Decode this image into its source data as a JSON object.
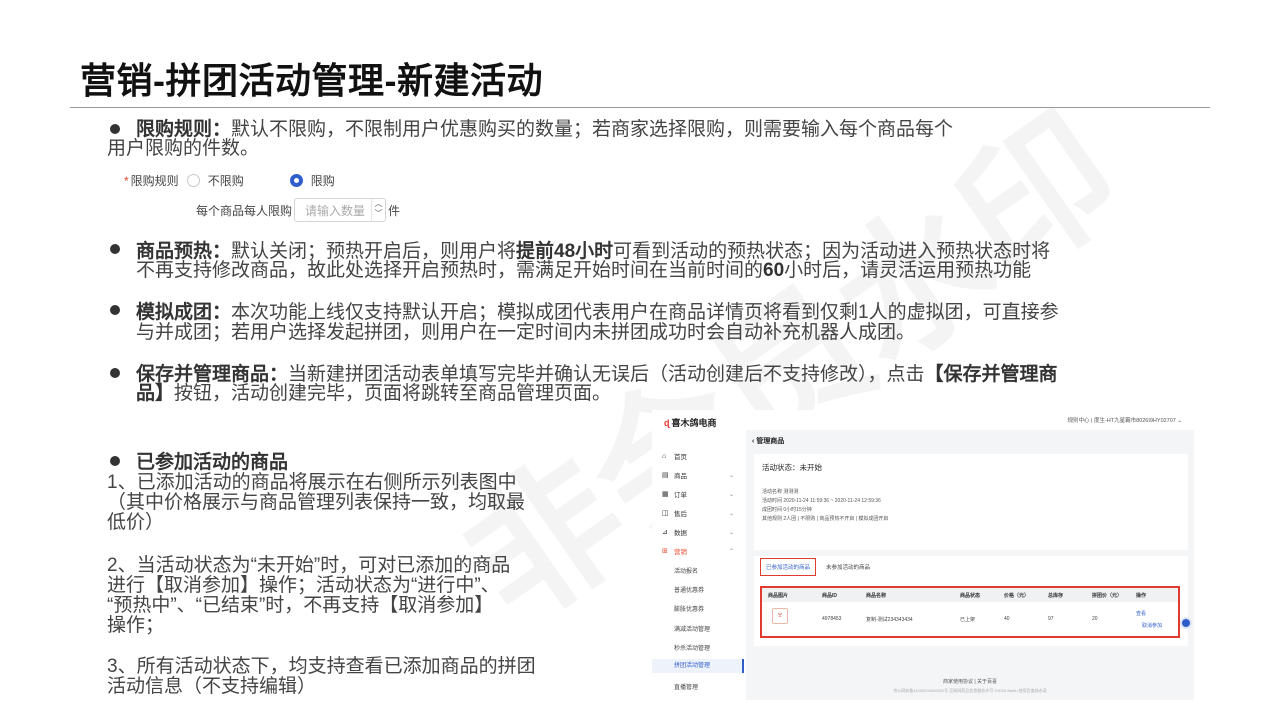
{
  "page": {
    "title": "营销-拼团活动管理-新建活动",
    "watermark": "非会员水印"
  },
  "sections": {
    "limit": {
      "label": "限购规则：",
      "text1": "默认不限购，不限制用户优惠购买的数量；若商家选择限购，则需要输入每个商品每个",
      "text2": "用户限购的件数。"
    },
    "preheat": {
      "label": "商品预热：",
      "text1a": "默认关闭；预热开启后，则用户将",
      "text1b": "提前48小时",
      "text1c": "可看到活动的预热状态；因为活动进入预热状态时将",
      "text2a": "不再支持修改商品，故此处选择开启预热时，需满足开始时间在当前时间的",
      "text2b": "60",
      "text2c": "小时后，请灵活运用预热功能"
    },
    "mock": {
      "label": "模拟成团：",
      "text1": "本次功能上线仅支持默认开启；模拟成团代表用户在商品详情页将看到仅剩1人的虚拟团，可直接参",
      "text2": "与并成团；若用户选择发起拼团，则用户在一定时间内未拼团成功时会自动补充机器人成团。"
    },
    "save": {
      "label": "保存并管理商品：",
      "text1a": "当新建拼团活动表单填写完毕并确认无误后（活动创建后不支持修改），点击",
      "text1b": "【保存并管理商",
      "text2a": "品】",
      "text2b": "按钮，活动创建完毕，页面将跳转至商品管理页面。"
    },
    "joined": {
      "heading": "已参加活动的商品",
      "p1": [
        "1、已添加活动的商品将展示在右侧所示列表图中",
        "（其中价格展示与商品管理列表保持一致，均取最",
        "低价）"
      ],
      "p2": [
        "2、当活动状态为“未开始”时，可对已添加的商品",
        "进行【取消参加】操作；活动状态为“进行中”、",
        "“预热中”、“已结束”时，不再支持【取消参加】",
        "操作；"
      ],
      "p3": [
        "3、所有活动状态下，均支持查看已添加商品的拼团",
        "活动信息（不支持编辑）"
      ]
    }
  },
  "form": {
    "required_mark": "*",
    "rule_label": "限购规则",
    "option_unlimited": "不限购",
    "option_limited": "限购",
    "selected": "限购",
    "per_label": "每个商品每人限购",
    "qty_placeholder": "请输入数量",
    "unit": "件"
  },
  "screenshot": {
    "logo": "喜木鸽电商",
    "topnav": "规则中心  |  度生-HT九星霸市8026I9HY02707 ⌄",
    "sidebar": [
      {
        "label": "首页",
        "icon": "home-icon",
        "glyph": "⌂"
      },
      {
        "label": "商品",
        "icon": "goods-icon",
        "glyph": "▤"
      },
      {
        "label": "订单",
        "icon": "order-icon",
        "glyph": "▦"
      },
      {
        "label": "售后",
        "icon": "aftersale-icon",
        "glyph": "◫"
      },
      {
        "label": "数据",
        "icon": "data-icon",
        "glyph": "⊿"
      },
      {
        "label": "营销",
        "icon": "marketing-icon",
        "glyph": "⊞"
      }
    ],
    "submenu": [
      "活动报名",
      "普通优惠券",
      "膨胀优惠券",
      "满减活动管理",
      "秒杀活动管理",
      "拼团活动管理",
      "直播管理"
    ],
    "active_sub": "拼团活动管理",
    "breadcrumb": "‹ 管理商品",
    "status": "活动状态：未开始",
    "info": [
      "活动名称  测测测",
      "活动时间  2020-11-24 11:59:36 ~ 2020-11-24 12:59:36",
      "成团时间  0小时15分钟",
      "其他规则  2人团 | 不限购 | 商品预热不开启 | 模拟成团开启"
    ],
    "tabs": [
      "已参加活动的商品",
      "未参加活动的商品"
    ],
    "columns": [
      "商品图片",
      "商品ID",
      "商品名称",
      "商品状态",
      "价格（元）",
      "总库存",
      "拼团价（元）",
      "操作"
    ],
    "row": {
      "id": "4978453",
      "name": "复制-测试234343434",
      "state": "已上架",
      "price": "40",
      "stock": "97",
      "group_price": "20",
      "op1": "查看",
      "op2": "取消参加"
    },
    "footer1": "商家使用协议  |  关于百喜",
    "footer2": "京公网安备11000002000001号 互联网药品信息服务许可 ©2020 Baidu 使用百度前必读"
  },
  "colors": {
    "accent": "#2f5ecb",
    "highlight": "#e13a2e"
  }
}
